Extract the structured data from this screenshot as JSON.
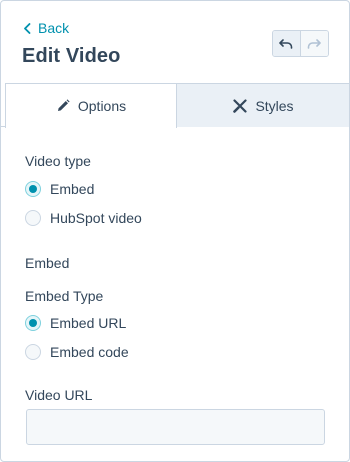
{
  "header": {
    "back_label": "Back",
    "title": "Edit Video",
    "undo_icon": "undo-icon",
    "redo_icon": "redo-icon"
  },
  "tabs": [
    {
      "label": "Options",
      "icon": "pencil-icon",
      "active": true
    },
    {
      "label": "Styles",
      "icon": "brush-icon",
      "active": false
    }
  ],
  "video_type": {
    "label": "Video type",
    "options": [
      {
        "label": "Embed",
        "checked": true
      },
      {
        "label": "HubSpot video",
        "checked": false
      }
    ]
  },
  "embed": {
    "heading": "Embed",
    "type_label": "Embed Type",
    "options": [
      {
        "label": "Embed URL",
        "checked": true
      },
      {
        "label": "Embed code",
        "checked": false
      }
    ]
  },
  "video_url": {
    "label": "Video URL",
    "value": "",
    "placeholder": ""
  },
  "colors": {
    "accent": "#0091ae",
    "text": "#33475b",
    "border": "#cbd6e2",
    "tab_inactive_bg": "#eaf0f6"
  }
}
